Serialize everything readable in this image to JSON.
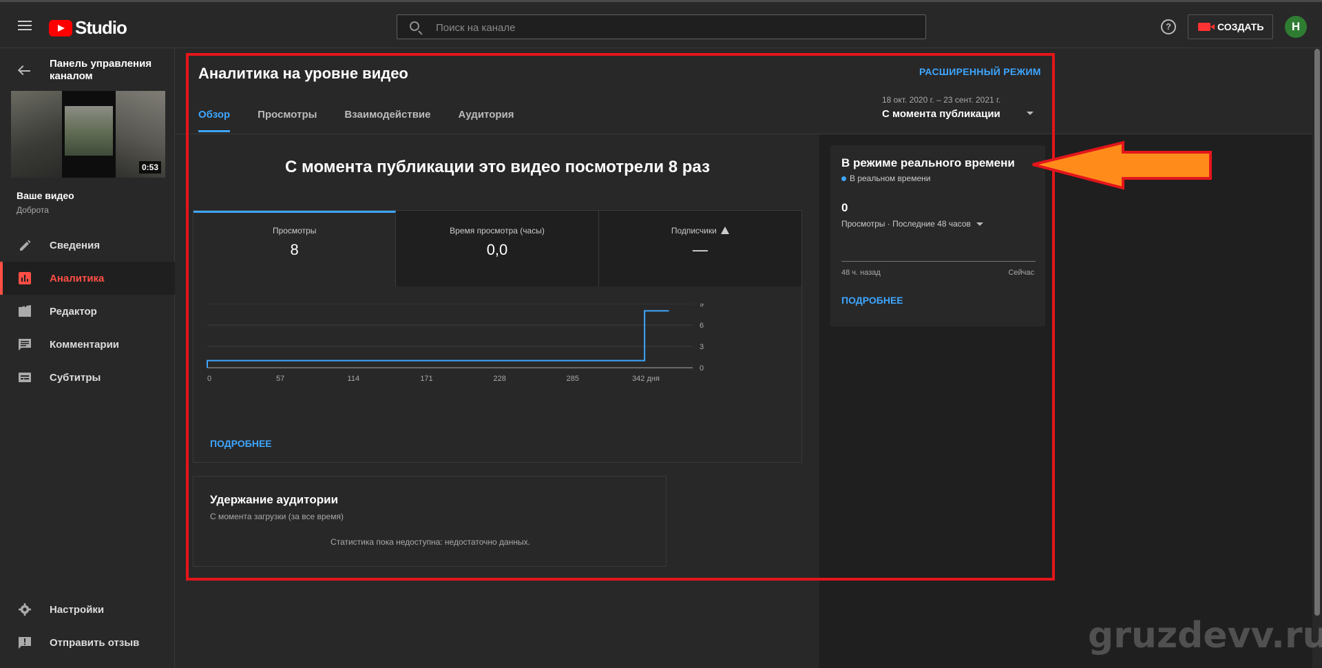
{
  "header": {
    "logo_text": "Studio",
    "search_placeholder": "Поиск на канале",
    "create_label": "СОЗДАТЬ",
    "avatar_letter": "Н",
    "help_glyph": "?"
  },
  "sidebar": {
    "back_label": "Панель управления каналом",
    "video_duration": "0:53",
    "your_video_label": "Ваше видео",
    "video_title": "Доброта",
    "items": [
      {
        "label": "Сведения",
        "icon": "pencil-icon",
        "active": false
      },
      {
        "label": "Аналитика",
        "icon": "analytics-icon",
        "active": true
      },
      {
        "label": "Редактор",
        "icon": "film-icon",
        "active": false
      },
      {
        "label": "Комментарии",
        "icon": "comment-icon",
        "active": false
      },
      {
        "label": "Субтитры",
        "icon": "subtitles-icon",
        "active": false
      }
    ],
    "bottom_items": [
      {
        "label": "Настройки",
        "icon": "gear-icon"
      },
      {
        "label": "Отправить отзыв",
        "icon": "feedback-icon"
      }
    ]
  },
  "page": {
    "title": "Аналитика на уровне видео",
    "advanced_mode": "РАСШИРЕННЫЙ РЕЖИМ",
    "tabs": [
      "Обзор",
      "Просмотры",
      "Взаимодействие",
      "Аудитория"
    ],
    "active_tab": 0,
    "date_range": "18 окт. 2020 г. – 23 сент. 2021 г.",
    "date_range_label": "С момента публикации",
    "headline": "С момента публикации это видео посмотрели 8 раз"
  },
  "metrics": [
    {
      "label": "Просмотры",
      "value": "8",
      "active": true
    },
    {
      "label": "Время просмотра (часы)",
      "value": "0,0",
      "active": false
    },
    {
      "label": "Подписчики",
      "value": "—",
      "active": false,
      "warning": true
    }
  ],
  "chart_data": {
    "type": "line",
    "x_ticks": [
      "0",
      "57",
      "114",
      "171",
      "228",
      "285",
      "342 дня"
    ],
    "y_ticks": [
      "9",
      "6",
      "3",
      "0"
    ],
    "ylim": [
      0,
      9
    ],
    "xlim": [
      0,
      342
    ],
    "series": [
      {
        "x": [
          0,
          0,
          341,
          341,
          360
        ],
        "y": [
          0,
          1,
          1,
          8,
          8
        ]
      }
    ],
    "line_color": "#3ea6ff",
    "grid": true
  },
  "chart_more": "ПОДРОБНЕЕ",
  "retention": {
    "title": "Удержание аудитории",
    "subtitle": "С момента загрузки (за все время)",
    "message": "Статистика пока недоступна: недостаточно данных."
  },
  "realtime": {
    "title": "В режиме реального времени",
    "live_label": "В реальном времени",
    "value": "0",
    "metric_label": "Просмотры · Последние 48 часов",
    "from_label": "48 ч. назад",
    "to_label": "Сейчас",
    "more": "ПОДРОБНЕЕ"
  },
  "watermark": "gruzdevv.ru",
  "colors": {
    "accent": "#3ea6ff",
    "active_nav": "#ff4e45",
    "highlight": "#e4151b",
    "arrow": "#ff8c1a"
  }
}
